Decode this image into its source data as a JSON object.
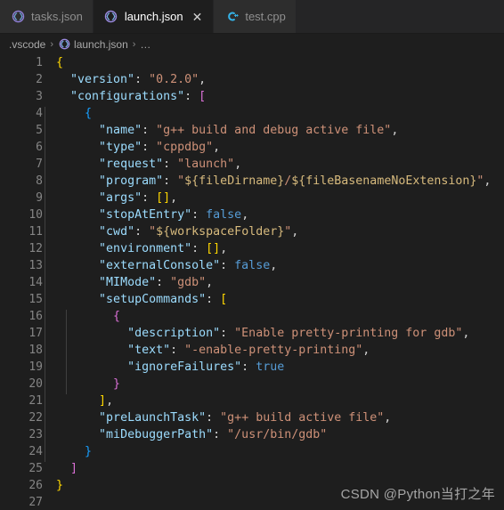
{
  "window": {
    "theme_colors": {
      "editor_background": "#1e1e1e",
      "tabbar_background": "#252526",
      "inactive_tab_background": "#2d2d2d",
      "active_tab_background": "#1e1e1e",
      "line_number": "#858585",
      "key_color": "#9cdcfe",
      "string_color": "#ce9178",
      "boolean_color": "#569cd6",
      "bracket_level1": "#ffd700",
      "bracket_level2": "#da70d6",
      "bracket_level3": "#179fff"
    }
  },
  "tabs": [
    {
      "label": "tasks.json",
      "icon": "json-file-icon",
      "active": false,
      "closable": false
    },
    {
      "label": "launch.json",
      "icon": "json-file-icon",
      "active": true,
      "closable": true,
      "close_label": "✕"
    },
    {
      "label": "test.cpp",
      "icon": "cpp-file-icon",
      "active": false,
      "closable": false
    }
  ],
  "breadcrumb": {
    "items": [
      {
        "label": ".vscode",
        "icon": null
      },
      {
        "label": "launch.json",
        "icon": "json-file-icon"
      },
      {
        "label": "…",
        "icon": null
      }
    ],
    "separator": "›"
  },
  "editor": {
    "language": "json",
    "total_lines": 27,
    "line_numbers": [
      "1",
      "2",
      "3",
      "4",
      "5",
      "6",
      "7",
      "8",
      "9",
      "10",
      "11",
      "12",
      "13",
      "14",
      "15",
      "16",
      "17",
      "18",
      "19",
      "20",
      "21",
      "22",
      "23",
      "24",
      "25",
      "26",
      "27"
    ],
    "lines": [
      {
        "n": "1",
        "indent_guides": 0,
        "text": "{"
      },
      {
        "n": "2",
        "indent_guides": 0,
        "text": "  \"version\": \"0.2.0\","
      },
      {
        "n": "3",
        "indent_guides": 0,
        "text": "  \"configurations\": ["
      },
      {
        "n": "4",
        "indent_guides": 1,
        "text": "    {"
      },
      {
        "n": "5",
        "indent_guides": 1,
        "text": "      \"name\": \"g++ build and debug active file\","
      },
      {
        "n": "6",
        "indent_guides": 1,
        "text": "      \"type\": \"cppdbg\","
      },
      {
        "n": "7",
        "indent_guides": 1,
        "text": "      \"request\": \"launch\","
      },
      {
        "n": "8",
        "indent_guides": 1,
        "text": "      \"program\": \"${fileDirname}/${fileBasenameNoExtension}\","
      },
      {
        "n": "9",
        "indent_guides": 1,
        "text": "      \"args\": [],"
      },
      {
        "n": "10",
        "indent_guides": 1,
        "text": "      \"stopAtEntry\": false,"
      },
      {
        "n": "11",
        "indent_guides": 1,
        "text": "      \"cwd\": \"${workspaceFolder}\","
      },
      {
        "n": "12",
        "indent_guides": 1,
        "text": "      \"environment\": [],"
      },
      {
        "n": "13",
        "indent_guides": 1,
        "text": "      \"externalConsole\": false,"
      },
      {
        "n": "14",
        "indent_guides": 1,
        "text": "      \"MIMode\": \"gdb\","
      },
      {
        "n": "15",
        "indent_guides": 1,
        "text": "      \"setupCommands\": ["
      },
      {
        "n": "16",
        "indent_guides": 2,
        "text": "        {"
      },
      {
        "n": "17",
        "indent_guides": 2,
        "text": "          \"description\": \"Enable pretty-printing for gdb\","
      },
      {
        "n": "18",
        "indent_guides": 2,
        "text": "          \"text\": \"-enable-pretty-printing\","
      },
      {
        "n": "19",
        "indent_guides": 2,
        "text": "          \"ignoreFailures\": true"
      },
      {
        "n": "20",
        "indent_guides": 2,
        "text": "        }"
      },
      {
        "n": "21",
        "indent_guides": 1,
        "text": "      ],"
      },
      {
        "n": "22",
        "indent_guides": 1,
        "text": "      \"preLaunchTask\": \"g++ build active file\","
      },
      {
        "n": "23",
        "indent_guides": 1,
        "text": "      \"miDebuggerPath\": \"/usr/bin/gdb\""
      },
      {
        "n": "24",
        "indent_guides": 1,
        "text": "    }"
      },
      {
        "n": "25",
        "indent_guides": 0,
        "text": "  ]"
      },
      {
        "n": "26",
        "indent_guides": 0,
        "text": "}"
      },
      {
        "n": "27",
        "indent_guides": 0,
        "text": ""
      }
    ],
    "json_content": {
      "version": "0.2.0",
      "configurations": [
        {
          "name": "g++ build and debug active file",
          "type": "cppdbg",
          "request": "launch",
          "program": "${fileDirname}/${fileBasenameNoExtension}",
          "args": [],
          "stopAtEntry": false,
          "cwd": "${workspaceFolder}",
          "environment": [],
          "externalConsole": false,
          "MIMode": "gdb",
          "setupCommands": [
            {
              "description": "Enable pretty-printing for gdb",
              "text": "-enable-pretty-printing",
              "ignoreFailures": true
            }
          ],
          "preLaunchTask": "g++ build active file",
          "miDebuggerPath": "/usr/bin/gdb"
        }
      ]
    }
  },
  "watermark": {
    "text": "CSDN @Python当打之年"
  }
}
